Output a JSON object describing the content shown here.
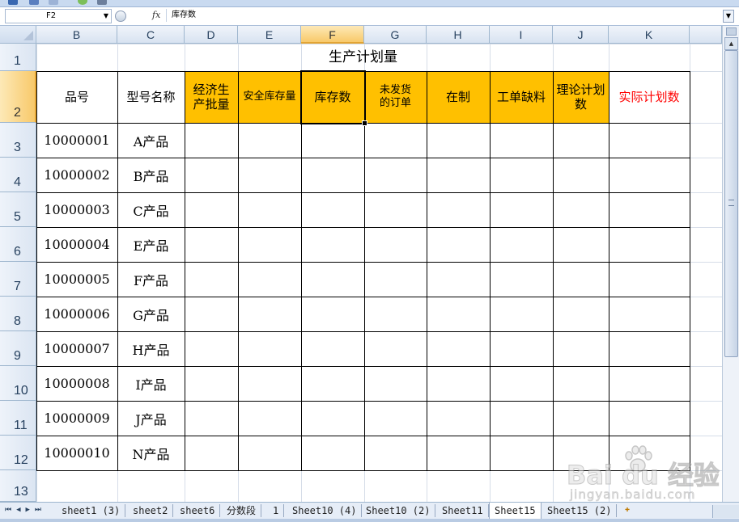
{
  "formula_bar": {
    "name_box": "F2",
    "fx": "fx",
    "content": "库存数"
  },
  "columns": [
    "B",
    "C",
    "D",
    "E",
    "F",
    "G",
    "H",
    "I",
    "J",
    "K"
  ],
  "rows": [
    "1",
    "2",
    "3",
    "4",
    "5",
    "6",
    "7",
    "8",
    "9",
    "10",
    "11",
    "12",
    "13"
  ],
  "selected_cell": "F2",
  "sheet": {
    "title": "生产计划量",
    "headers": [
      {
        "text": "品号"
      },
      {
        "text": "型号名称"
      },
      {
        "text": "经济生\n产批量",
        "highlight": true
      },
      {
        "text": "安全库存量",
        "highlight": true
      },
      {
        "text": "库存数",
        "highlight": true
      },
      {
        "text": "未发货\n的订单",
        "highlight": true
      },
      {
        "text": "在制",
        "highlight": true
      },
      {
        "text": "工单缺料",
        "highlight": true
      },
      {
        "text": "理论计划\n数",
        "highlight": true
      },
      {
        "text": "实际计划数",
        "red": true
      }
    ],
    "data_rows": [
      {
        "id": "10000001",
        "name": "A产品"
      },
      {
        "id": "10000002",
        "name": "B产品"
      },
      {
        "id": "10000003",
        "name": "C产品"
      },
      {
        "id": "10000004",
        "name": "E产品"
      },
      {
        "id": "10000005",
        "name": "F产品"
      },
      {
        "id": "10000006",
        "name": "G产品"
      },
      {
        "id": "10000007",
        "name": "H产品"
      },
      {
        "id": "10000008",
        "name": "I产品"
      },
      {
        "id": "10000009",
        "name": "J产品"
      },
      {
        "id": "10000010",
        "name": "N产品"
      }
    ]
  },
  "tabs": [
    {
      "label": "sheet1 (3)"
    },
    {
      "label": "sheet2"
    },
    {
      "label": "sheet6"
    },
    {
      "label": "分数段"
    },
    {
      "label": "1"
    },
    {
      "label": "Sheet10 (4)"
    },
    {
      "label": "Sheet10 (2)"
    },
    {
      "label": "Sheet11"
    },
    {
      "label": "Sheet15",
      "active": true
    },
    {
      "label": "Sheet15 (2)"
    }
  ],
  "colors": {
    "header_fill": "#ffc000",
    "red_text": "#ff0000",
    "selected_header": "#f8c96a"
  },
  "watermark": {
    "brand": "Bai du 经验",
    "url": "jingyan.baidu.com"
  }
}
